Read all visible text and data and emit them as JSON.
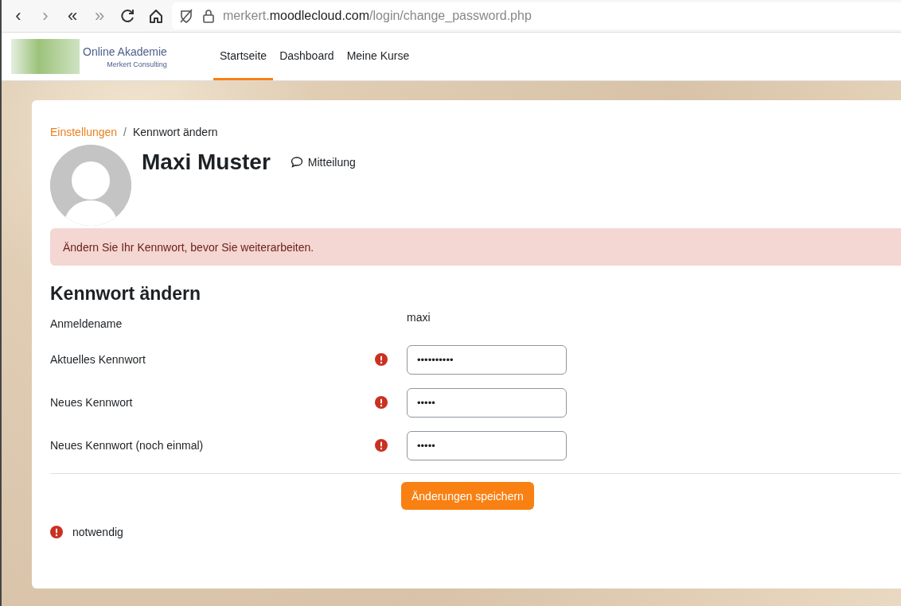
{
  "browser": {
    "nav_buttons": [
      "‹",
      "›",
      "«",
      "»"
    ],
    "url": {
      "prefix": "merkert.",
      "domain": "moodlecloud.com",
      "path": "/login/change_password.php"
    }
  },
  "site": {
    "logo_title": "Online Akademie",
    "logo_subtitle": "Merkert Consulting",
    "nav": [
      {
        "label": "Startseite",
        "selected": true
      },
      {
        "label": "Dashboard",
        "selected": false
      },
      {
        "label": "Meine Kurse",
        "selected": false
      }
    ]
  },
  "breadcrumb": [
    {
      "label": "Einstellungen",
      "kind": "link"
    },
    {
      "label": "Kennwort ändern",
      "kind": "current",
      "separator": "/"
    }
  ],
  "profile": {
    "name": "Maxi Muster",
    "message_link": "Mitteilung"
  },
  "alert": "Ändern Sie Ihr Kennwort, bevor Sie weiterarbeiten.",
  "form": {
    "title": "Kennwort ändern",
    "fields": [
      {
        "label": "Anmeldename",
        "kind": "static",
        "required": false,
        "value": "maxi"
      },
      {
        "label": "Aktuelles Kennwort",
        "kind": "password",
        "required": true,
        "value": "••••••••••"
      },
      {
        "label": "Neues Kennwort",
        "kind": "password",
        "required": true,
        "value": "•••••"
      },
      {
        "label": "Neues Kennwort (noch einmal)",
        "kind": "password",
        "required": true,
        "value": "•••••"
      }
    ],
    "submit": "Änderungen speichern",
    "required_note": "notwendig"
  }
}
